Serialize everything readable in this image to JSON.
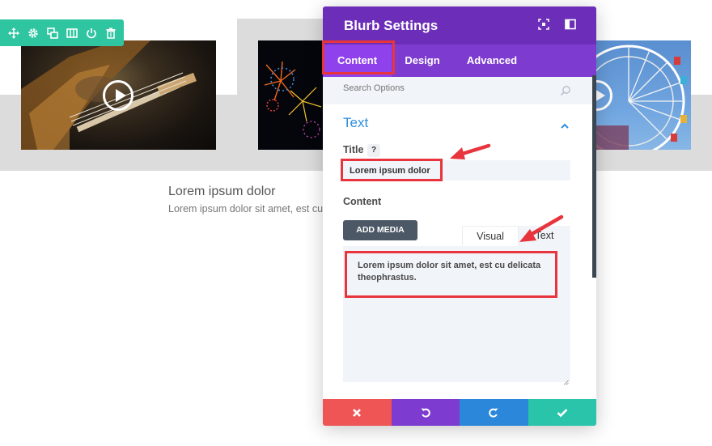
{
  "background_page": {
    "blurb_title": "Lorem ipsum dolor",
    "blurb_body": "Lorem ipsum dolor sit amet, est cu",
    "toolbar_icons": [
      "move-icon",
      "gear-icon",
      "duplicate-icon",
      "columns-icon",
      "power-icon",
      "trash-icon"
    ]
  },
  "modal": {
    "title": "Blurb Settings",
    "header_icons": [
      "fullscreen-icon",
      "sidebar-layout-icon"
    ],
    "tabs": [
      {
        "label": "Content",
        "active": true
      },
      {
        "label": "Design",
        "active": false
      },
      {
        "label": "Advanced",
        "active": false
      }
    ],
    "search_placeholder": "Search Options",
    "section_title": "Text",
    "title_field": {
      "label": "Title",
      "help": "?",
      "value": "Lorem ipsum dolor"
    },
    "content_field": {
      "label": "Content",
      "add_media": "ADD MEDIA",
      "editor_tabs": [
        "Visual",
        "Text"
      ],
      "value": "Lorem ipsum dolor sit amet, est cu delicata theophrastus."
    },
    "footer_buttons": [
      "close-icon",
      "undo-icon",
      "redo-icon",
      "check-icon"
    ]
  },
  "colors": {
    "accent_purple": "#6c2eb9",
    "tab_purple": "#7e3bd0",
    "highlight_red": "#e8343c",
    "teal": "#2fc5a0",
    "section_blue": "#2e8edc"
  }
}
